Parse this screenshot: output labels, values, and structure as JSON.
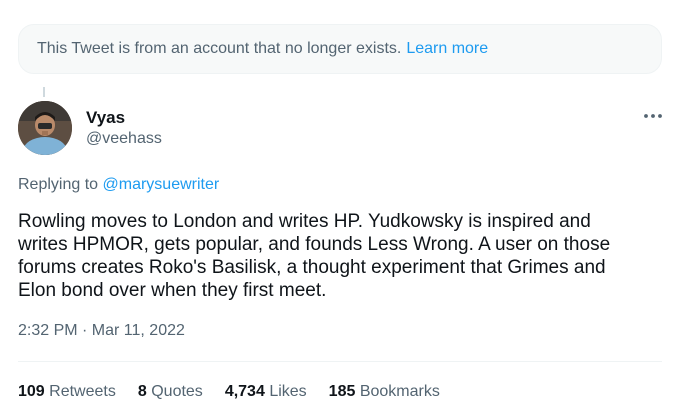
{
  "notice": {
    "text": "This Tweet is from an account that no longer exists.",
    "link": "Learn more"
  },
  "author": {
    "name": "Vyas",
    "handle": "@veehass"
  },
  "more_icon": "more-horizontal-icon",
  "reply": {
    "prefix": "Replying to",
    "mention": "@marysuewriter"
  },
  "tweet": {
    "lines": [
      "Rowling moves to London and writes HP. Yudkowsky is inspired and",
      "writes HPMOR, gets popular, and founds Less Wrong. A user on those",
      "forums creates Roko's Basilisk, a thought experiment that Grimes and",
      "Elon bond over when they first meet."
    ],
    "timestamp": "2:32 PM · Mar 11, 2022"
  },
  "stats": [
    {
      "count": "109",
      "label": "Retweets"
    },
    {
      "count": "8",
      "label": "Quotes"
    },
    {
      "count": "4,734",
      "label": "Likes"
    },
    {
      "count": "185",
      "label": "Bookmarks"
    }
  ],
  "colors": {
    "accent": "#1d9bf0",
    "muted": "#536471",
    "text": "#0f1419"
  }
}
